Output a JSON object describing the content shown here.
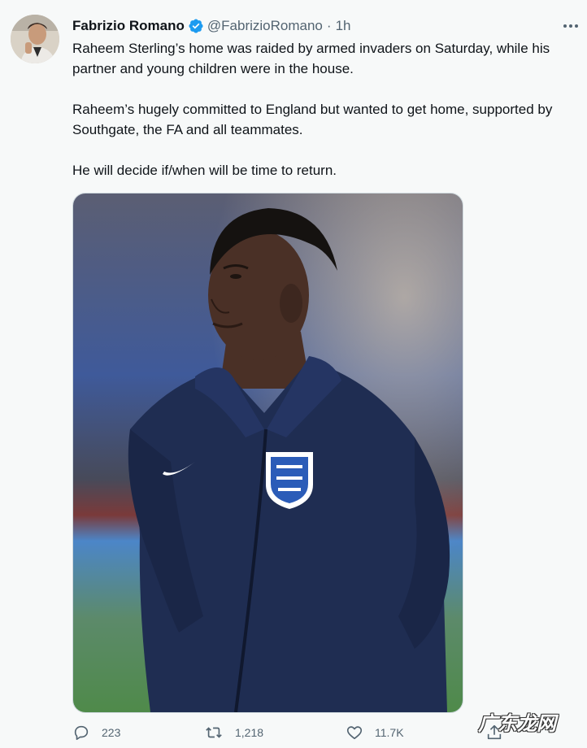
{
  "tweet": {
    "author_name": "Fabrizio Romano",
    "handle": "@FabrizioRomano",
    "separator": "·",
    "time": "1h",
    "paragraphs": [
      "Raheem Sterling’s home was raided by armed invaders on Saturday, while his partner and young children were in the house.",
      "Raheem’s hugely committed to England but wanted to get home, supported by Southgate, the FA and all teammates.",
      "He will decide if/when will be time to return."
    ]
  },
  "actions": {
    "replies": "223",
    "retweets": "1,218",
    "likes": "11.7K"
  },
  "watermark": "广东龙网",
  "icons": [
    "verified-badge-icon",
    "more-options-icon",
    "reply-icon",
    "retweet-icon",
    "like-icon",
    "share-icon"
  ],
  "colors": {
    "background": "#f7f9f9",
    "text": "#0f1419",
    "secondary_text": "#536471",
    "verified": "#1d9bf0",
    "jacket": "#1f2d52"
  }
}
